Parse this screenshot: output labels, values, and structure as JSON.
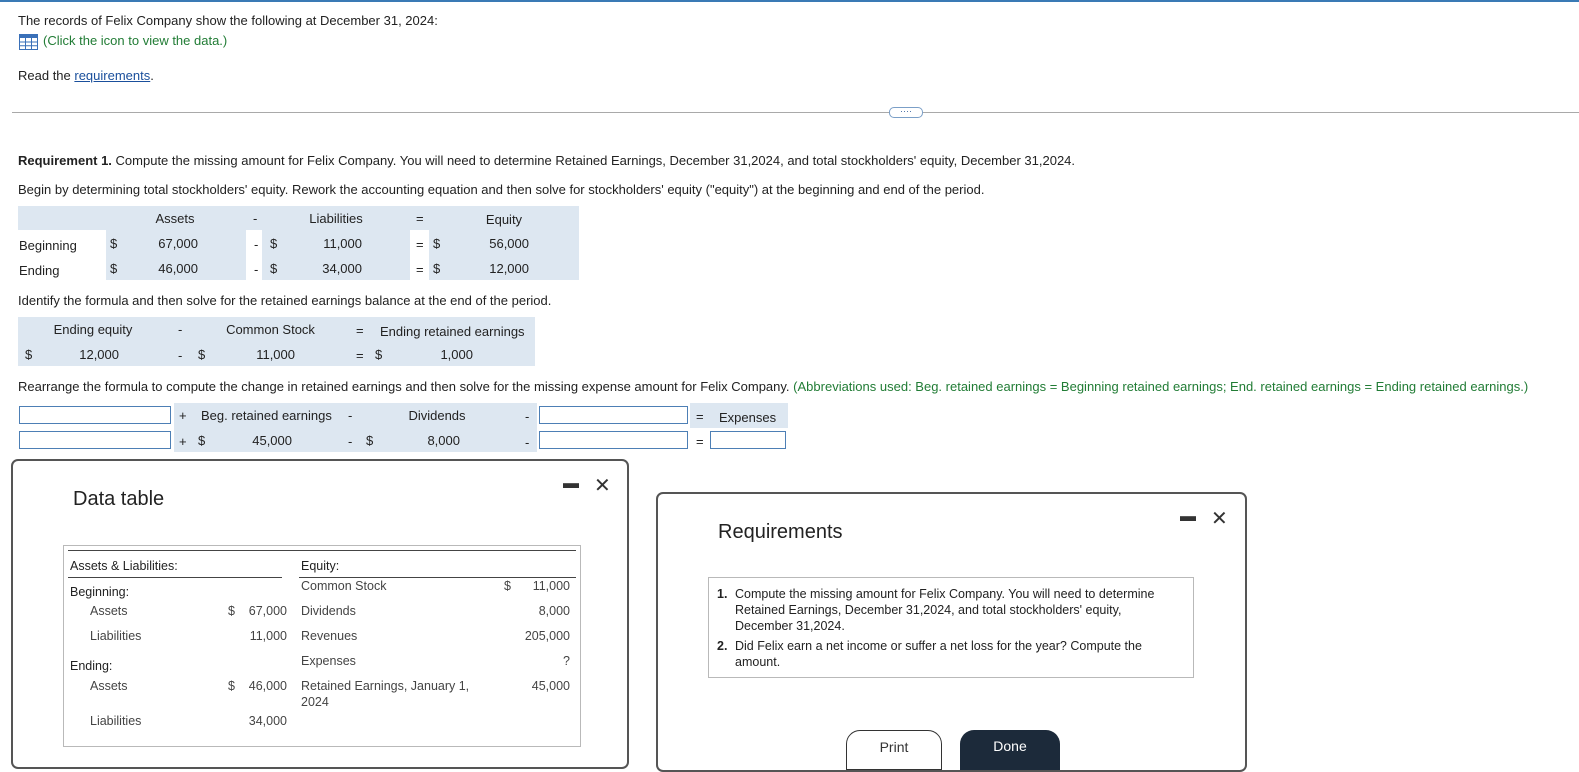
{
  "problem": {
    "intro": "The records of Felix Company show the following at December 31, 2024:",
    "data_link": "(Click the icon to view the data.)",
    "read_prefix": "Read the ",
    "read_link": "requirements",
    "read_suffix": "."
  },
  "req1": {
    "bold": "Requirement 1.",
    "text": " Compute the missing amount for Felix Company. You will need to determine Retained Earnings, December 31,2024, and total stockholders' equity, December 31,2024.",
    "begin": "Begin by determining total stockholders' equity. Rework the accounting equation and then solve for stockholders' equity (\"equity\") at the beginning and end of the period."
  },
  "equity_table": {
    "h_assets": "Assets",
    "h_minus": "-",
    "h_liab": "Liabilities",
    "h_eq": "=",
    "h_equity": "Equity",
    "rows": [
      {
        "label": "Beginning",
        "cur1": "$",
        "assets": "67,000",
        "minus": "-",
        "cur2": "$",
        "liab": "11,000",
        "eq": "=",
        "cur3": "$",
        "equity": "56,000"
      },
      {
        "label": "Ending",
        "cur1": "$",
        "assets": "46,000",
        "minus": "-",
        "cur2": "$",
        "liab": "34,000",
        "eq": "=",
        "cur3": "$",
        "equity": "12,000"
      }
    ]
  },
  "re_section": {
    "instruction": "Identify the formula and then solve for the retained earnings balance at the end of the period.",
    "h_end_equity": "Ending equity",
    "h_minus": "-",
    "h_cs": "Common Stock",
    "h_eq": "=",
    "h_end_re": "Ending retained earnings",
    "cur1": "$",
    "end_equity": "12,000",
    "minus": "-",
    "cur2": "$",
    "cs": "11,000",
    "eq": "=",
    "cur3": "$",
    "end_re": "1,000"
  },
  "rearrange": {
    "text": "Rearrange the formula to compute the change in retained earnings and then solve for the missing expense amount for Felix Company.",
    "abbrev": "(Abbreviations used: Beg. retained earnings = Beginning retained earnings; End. retained earnings = Ending retained earnings.)",
    "h_plus": "+",
    "h_beg_re": "Beg. retained earnings",
    "h_minus1": "-",
    "h_div": "Dividends",
    "h_minus2": "-",
    "h_eq": "=",
    "h_exp": "Expenses",
    "plus": "+",
    "cur1": "$",
    "beg_re": "45,000",
    "minus1": "-",
    "cur2": "$",
    "div": "8,000",
    "minus2": "-",
    "eq": "="
  },
  "data_table": {
    "title": "Data table",
    "al_header": "Assets & Liabilities:",
    "eq_header": "Equity:",
    "beginning": "Beginning:",
    "ending": "Ending:",
    "assets": "Assets",
    "liabilities": "Liabilities",
    "cur": "$",
    "beg_assets": "67,000",
    "beg_liab": "11,000",
    "end_assets": "46,000",
    "end_liab": "34,000",
    "cs": "Common Stock",
    "cs_val": "11,000",
    "div": "Dividends",
    "div_val": "8,000",
    "rev": "Revenues",
    "rev_val": "205,000",
    "exp": "Expenses",
    "exp_val": "?",
    "re_line1": "Retained Earnings, January 1,",
    "re_line2": "2024",
    "re_val": "45,000",
    "minimize": "▬",
    "close": "✕"
  },
  "requirements": {
    "title": "Requirements",
    "item1_num": "1.",
    "item1_l1": "Compute the missing amount for Felix Company. You will need to determine",
    "item1_l2": "Retained Earnings, December 31,2024, and total stockholders' equity,",
    "item1_l3": "December 31,2024.",
    "item2_num": "2.",
    "item2_l1": "Did Felix earn a net income or suffer a net loss for the year? Compute the",
    "item2_l2": "amount.",
    "print": "Print",
    "done": "Done",
    "minimize": "▬",
    "close": "✕"
  }
}
